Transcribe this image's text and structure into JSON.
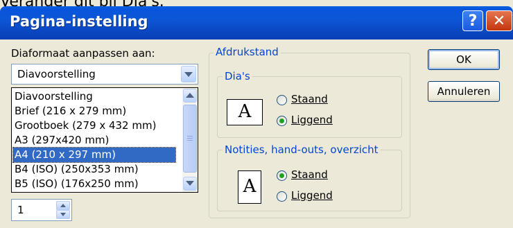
{
  "background_text": "Verander dit bij Dia's.",
  "window": {
    "title": "Pagina-instelling",
    "help_glyph": "?",
    "close_glyph": "✕"
  },
  "left": {
    "size_label": "Diaformaat aanpassen aan:",
    "combo_value": "Diavoorstelling",
    "list_items": [
      "Diavoorstelling",
      "Brief (216 x 279 mm)",
      "Grootboek (279 x 432 mm)",
      "A3 (297x420 mm)",
      "A4 (210 x 297 mm)",
      "B4 (ISO) (250x353 mm)",
      "B5 (ISO) (176x250 mm)"
    ],
    "selected_index": 4,
    "spinner_value": "1"
  },
  "orientation": {
    "group_label": "Afdrukstand",
    "slides": {
      "label": "Dia's",
      "portrait": "Staand",
      "landscape": "Liggend",
      "selected": "landscape",
      "icon_letter": "A"
    },
    "notes": {
      "label": "Notities, hand-outs, overzicht",
      "portrait": "Staand",
      "landscape": "Liggend",
      "selected": "portrait",
      "icon_letter": "A"
    }
  },
  "buttons": {
    "ok": "OK",
    "cancel": "Annuleren"
  },
  "colors": {
    "titlebar": "#0a5fe0",
    "selection": "#316ac5",
    "group_label": "#0046d5"
  }
}
